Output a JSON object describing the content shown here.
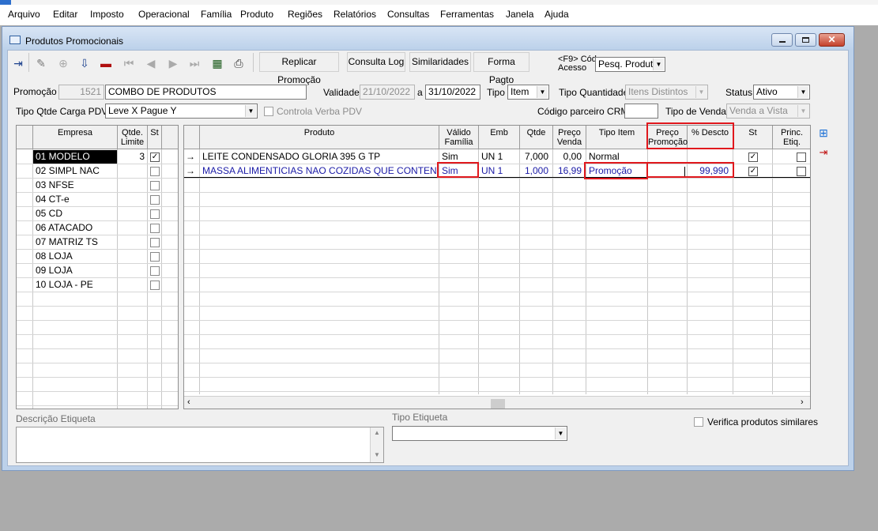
{
  "menu": [
    "Arquivo",
    "Editar",
    "Imposto",
    "Operacional",
    "Família",
    "Produto",
    "Regiões",
    "Relatórios",
    "Consultas",
    "Ferramentas",
    "Janela",
    "Ajuda"
  ],
  "window": {
    "title": "Produtos Promocionais"
  },
  "toolbar": {
    "icons": [
      "exit-icon",
      "edit-pencil-icon",
      "add-record-icon",
      "save-icon",
      "delete-icon",
      "first-record-icon",
      "previous-record-icon",
      "next-record-icon",
      "last-record-icon",
      "table-view-icon",
      "print-icon"
    ],
    "buttons": [
      "Replicar Promoção",
      "Consulta Log",
      "Similaridades",
      "Forma Pagto"
    ],
    "access_label_1": "<F9> Cód",
    "access_label_2": "Acesso",
    "access_value": "Pesq. Produto"
  },
  "form": {
    "promocao_label": "Promoção",
    "promocao_num": "1521",
    "promocao_name": "COMBO DE PRODUTOS",
    "validade_label": "Validade",
    "validade_from": "21/10/2022",
    "validade_a": "a",
    "validade_to": "31/10/2022",
    "tipo_label": "Tipo",
    "tipo_value": "Item",
    "tipo_qtd_label": "Tipo Quantidade",
    "tipo_qtd_value": "Itens Distintos",
    "status_label": "Status",
    "status_value": "Ativo",
    "tipo_carga_label": "Tipo Qtde Carga PDV",
    "tipo_carga_value": "Leve X Pague Y",
    "controla_verba_label": "Controla Verba PDV",
    "codigo_crm_label": "Código parceiro CRM",
    "codigo_crm_value": "",
    "tipo_venda_label": "Tipo de Venda",
    "tipo_venda_value": "Venda a Vista"
  },
  "empresas": {
    "headers": [
      "Empresa",
      "Qtde. Limite",
      "St"
    ],
    "rows": [
      {
        "name": "01 MODELO",
        "limite": "3",
        "checked": true,
        "selected": true
      },
      {
        "name": "02 SIMPL NAC",
        "limite": "",
        "checked": false
      },
      {
        "name": "03 NFSE",
        "limite": "",
        "checked": false
      },
      {
        "name": "04 CT-e",
        "limite": "",
        "checked": false
      },
      {
        "name": "05 CD",
        "limite": "",
        "checked": false
      },
      {
        "name": "06 ATACADO",
        "limite": "",
        "checked": false
      },
      {
        "name": "07 MATRIZ TS",
        "limite": "",
        "checked": false
      },
      {
        "name": "08 LOJA",
        "limite": "",
        "checked": false
      },
      {
        "name": "09 LOJA",
        "limite": "",
        "checked": false
      },
      {
        "name": "10 LOJA - PE",
        "limite": "",
        "checked": false
      }
    ]
  },
  "produtos": {
    "headers": [
      "Produto",
      "Válido Família",
      "Emb",
      "Qtde",
      "Preço Venda",
      "Tipo Item",
      "Preço Promoção",
      "% Descto",
      "St",
      "Princ. Etiq."
    ],
    "rows": [
      {
        "arrow": "→",
        "produto": "LEITE CONDENSADO GLORIA 395 G TP",
        "valido": "Sim",
        "emb": "UN  1",
        "qtde": "7,000",
        "preco": "0,00",
        "tipo": "Normal",
        "preco_promo": "",
        "descto": "",
        "st": true,
        "princ": false
      },
      {
        "arrow": "→",
        "produto": "MASSA ALIMENTICIAS NAO COZIDAS QUE CONTENHAM OVOS",
        "valido": "Sim",
        "emb": "UN  1",
        "qtde": "1,000",
        "preco": "16,99",
        "tipo": "Promoção",
        "preco_promo": "",
        "descto": "99,990",
        "st": true,
        "princ": false
      }
    ]
  },
  "side_icons": [
    "add-item-icon",
    "remove-item-icon"
  ],
  "bottom": {
    "descricao_label": "Descrição Etiqueta",
    "descricao_value": "",
    "tipo_etiqueta_label": "Tipo Etiqueta",
    "tipo_etiqueta_value": "",
    "verifica_label": "Verifica produtos similares"
  },
  "colors": {
    "highlight_red": "#e0181d",
    "selection_navy": "#000080",
    "row_blue_text": "#1a1aa6"
  }
}
